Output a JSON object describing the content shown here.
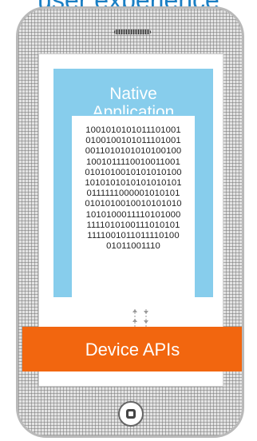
{
  "title": "user experience",
  "native_label": "Native",
  "native_sublabel": "Application",
  "binary_lines": [
    "1001010101011101001",
    "0100100101011101001",
    "0011010101010100100",
    "1001011110010011001",
    "0101010010101010100",
    "1010101010101010101",
    "0111111000001010101",
    "0101010010010101010",
    "1010100011110101000",
    "1111010100111010101",
    "1111001011011110100",
    "01011001110"
  ],
  "device_label": "Device APIs",
  "colors": {
    "title": "#1a7fc4",
    "native_box": "#87cdec",
    "device_box": "#f2660f"
  },
  "icons": {
    "speaker": "speaker-grille-icon",
    "home": "home-button-icon",
    "arrows": "bidirectional-arrows-icon"
  }
}
